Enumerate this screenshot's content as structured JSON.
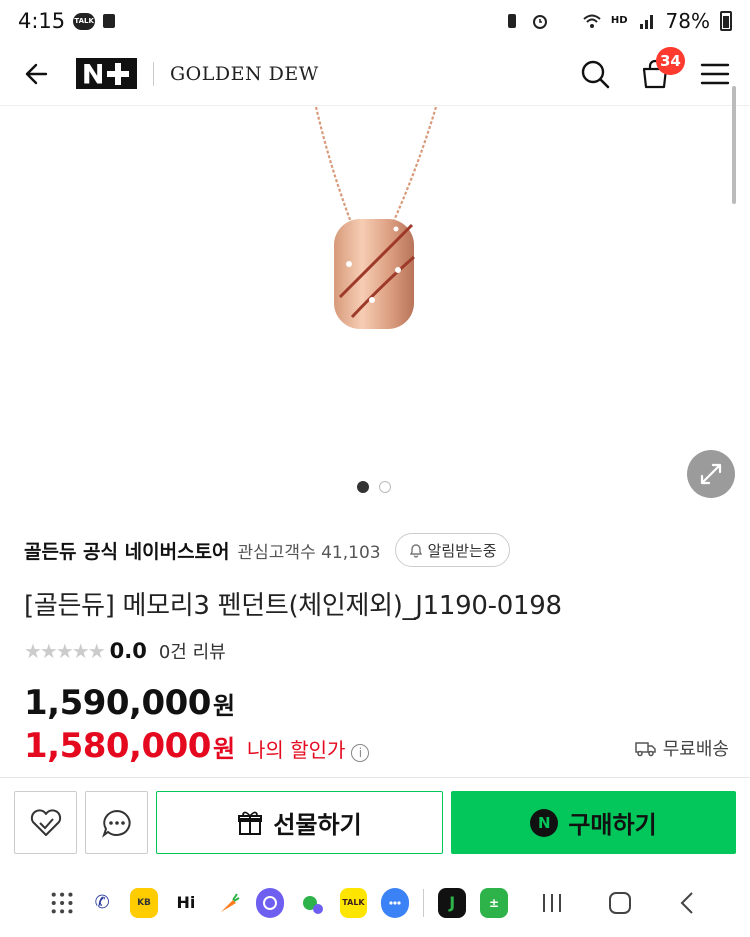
{
  "status": {
    "time": "4:15",
    "talk_badge": "TALK",
    "hd_label": "HD",
    "battery": "78%"
  },
  "header": {
    "brand": "GOLDEN DEW",
    "cart_count": "34"
  },
  "gallery": {
    "slide_count": 2,
    "active_index": 0
  },
  "store": {
    "name": "골든듀 공식 네이버스토어",
    "fans_label": "관심고객수 41,103",
    "alarm_label": "알림받는중"
  },
  "product": {
    "title": "[골든듀] 메모리3 펜던트(체인제외)_J1190-0198",
    "stars": "★★★★★",
    "rating": "0.0",
    "reviews": "0건 리뷰",
    "price": "1,590,000",
    "price_unit": "원",
    "sale_price": "1,580,000",
    "sale_unit": "원",
    "sale_label": "나의 할인가",
    "shipping": "무료배송"
  },
  "actions": {
    "gift_label": "선물하기",
    "buy_label": "구매하기",
    "buy_badge": "N"
  },
  "navbar_apps": [
    "phone-app",
    "kb-pay-app",
    "hi-app",
    "carrot-app",
    "samsung-internet-app",
    "app-with-badge",
    "kakaotalk-app",
    "messages-app",
    "jandi-app",
    "calculator-app"
  ],
  "colors": {
    "naver_green": "#03c75a",
    "sale_red": "#e5091f",
    "badge_red": "#ff3b30"
  }
}
